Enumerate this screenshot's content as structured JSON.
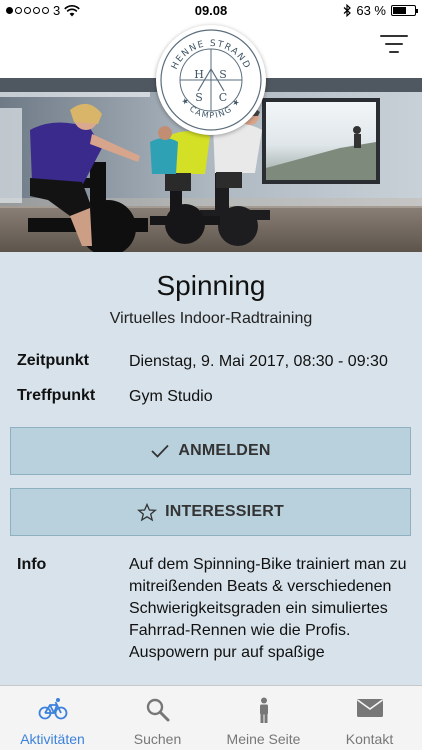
{
  "status_bar": {
    "carrier": "3",
    "time": "09.08",
    "battery": "63 %",
    "battery_level": 0.63
  },
  "logo": {
    "text": "HENNE STRAND CAMPING"
  },
  "event": {
    "title": "Spinning",
    "subtitle": "Virtuelles Indoor-Radtraining",
    "time_label": "Zeitpunkt",
    "time_value": "Dienstag, 9. Mai 2017, 08:30 - 09:30",
    "place_label": "Treffpunkt",
    "place_value": "Gym Studio",
    "register_label": "ANMELDEN",
    "interested_label": "INTERESSIERT",
    "info_label": "Info",
    "info_text": "Auf dem Spinning-Bike trainiert man zu mitreißenden Beats & verschiedenen Schwierigkeitsgraden ein simuliertes Fahrrad-Rennen wie die Profis. Auspowern pur auf spaßige"
  },
  "tabs": [
    {
      "label": "Aktivitäten",
      "icon": "bicycle-icon",
      "active": true
    },
    {
      "label": "Suchen",
      "icon": "search-icon",
      "active": false
    },
    {
      "label": "Meine Seite",
      "icon": "person-icon",
      "active": false
    },
    {
      "label": "Kontakt",
      "icon": "mail-icon",
      "active": false
    }
  ],
  "colors": {
    "background": "#d7e2ea",
    "button": "#b9d1dd",
    "active_tab": "#3c82dc"
  }
}
